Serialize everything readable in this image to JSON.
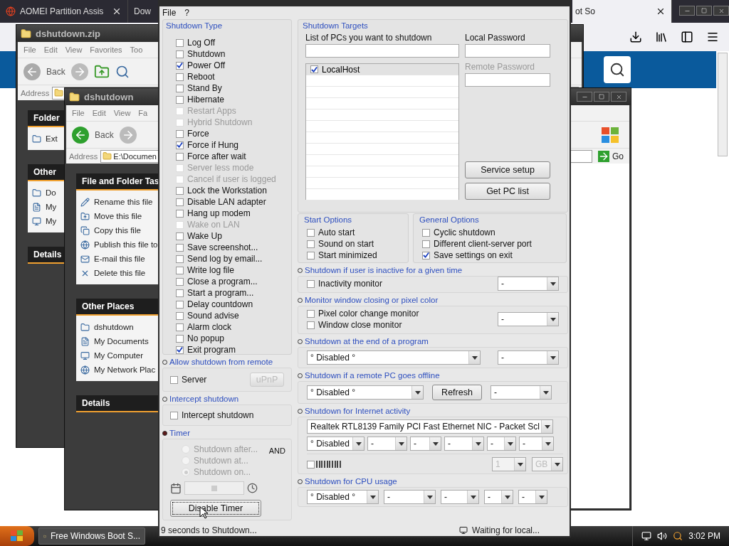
{
  "browser": {
    "tabs": [
      {
        "label": "AOMEI Partition Assis",
        "selected": false
      },
      {
        "label": "Dow",
        "selected": false
      },
      {
        "label": "ot So",
        "selected": true
      }
    ]
  },
  "explorer_back": {
    "title": "dshutdown.zip",
    "menu": [
      "File",
      "Edit",
      "View",
      "Favorites",
      "Too"
    ],
    "back": "Back",
    "address_label": "Address",
    "panels": [
      {
        "title": "Folder",
        "items": [
          "Ext"
        ]
      },
      {
        "title": "Other",
        "items": [
          "Do",
          "My",
          "My"
        ]
      },
      {
        "title": "Details"
      }
    ]
  },
  "explorer_front": {
    "title": "dshutdown",
    "menu": [
      "File",
      "Edit",
      "View",
      "Fa"
    ],
    "back": "Back",
    "address_label": "Address",
    "address": "E:\\Documen",
    "go": "Go",
    "panels": [
      {
        "title": "File and Folder Tas",
        "items": [
          "Rename this file",
          "Move this file",
          "Copy this file",
          "Publish this file to",
          "E-mail this file",
          "Delete this file"
        ]
      },
      {
        "title": "Other Places",
        "items": [
          "dshutdown",
          "My Documents",
          "My Computer",
          "My Network Plac"
        ]
      },
      {
        "title": "Details"
      }
    ]
  },
  "dialog": {
    "menu": [
      "File",
      "?"
    ],
    "shutdown_type": {
      "title": "Shutdown Type",
      "options": [
        {
          "label": "Log Off",
          "checked": false,
          "disabled": false
        },
        {
          "label": "Shutdown",
          "checked": false,
          "disabled": false
        },
        {
          "label": "Power Off",
          "checked": true,
          "disabled": false
        },
        {
          "label": "Reboot",
          "checked": false,
          "disabled": false
        },
        {
          "label": "Stand By",
          "checked": false,
          "disabled": false
        },
        {
          "label": "Hibernate",
          "checked": false,
          "disabled": false
        },
        {
          "label": "Restart Apps",
          "checked": false,
          "disabled": true
        },
        {
          "label": "Hybrid Shutdown",
          "checked": false,
          "disabled": true
        },
        {
          "label": "Force",
          "checked": false,
          "disabled": false
        },
        {
          "label": "Force if Hung",
          "checked": true,
          "disabled": false
        },
        {
          "label": "Force after wait",
          "checked": false,
          "disabled": false
        },
        {
          "label": "Server less mode",
          "checked": false,
          "disabled": true
        },
        {
          "label": "Cancel if user is logged",
          "checked": false,
          "disabled": true
        },
        {
          "label": "Lock the Workstation",
          "checked": false,
          "disabled": false
        },
        {
          "label": "Disable LAN adapter",
          "checked": false,
          "disabled": false
        },
        {
          "label": "Hang up modem",
          "checked": false,
          "disabled": false
        },
        {
          "label": "Wake on LAN",
          "checked": false,
          "disabled": true
        },
        {
          "label": "Wake Up",
          "checked": false,
          "disabled": false
        },
        {
          "label": "Save screenshot...",
          "checked": false,
          "disabled": false
        },
        {
          "label": "Send log by email...",
          "checked": false,
          "disabled": false
        },
        {
          "label": "Write log file",
          "checked": false,
          "disabled": false
        },
        {
          "label": "Close a program...",
          "checked": false,
          "disabled": false
        },
        {
          "label": "Start a program...",
          "checked": false,
          "disabled": false
        },
        {
          "label": "Delay countdown",
          "checked": false,
          "disabled": false
        },
        {
          "label": "Sound advise",
          "checked": false,
          "disabled": false
        },
        {
          "label": "Alarm clock",
          "checked": false,
          "disabled": false
        },
        {
          "label": "No popup",
          "checked": false,
          "disabled": false
        },
        {
          "label": "Exit program",
          "checked": true,
          "disabled": false
        }
      ]
    },
    "remote": {
      "title": "Allow shutdown from remote",
      "active": false,
      "server": {
        "label": "Server",
        "checked": false
      },
      "upnp": {
        "label": "uPnP",
        "disabled": true
      }
    },
    "intercept": {
      "title": "Intercept shutdown",
      "active": false,
      "option": {
        "label": "Intercept shutdown",
        "checked": false
      }
    },
    "timer": {
      "title": "Timer",
      "active": true,
      "and": "AND",
      "modes": [
        {
          "label": "Shutdown after...",
          "selected": false
        },
        {
          "label": "Shutdown at...",
          "selected": false
        },
        {
          "label": "Shutdown on...",
          "selected": true
        }
      ],
      "button": "Disable Timer"
    },
    "status": "9 seconds to Shutdown...",
    "status_right": "Waiting for local...",
    "targets": {
      "title": "Shutdown Targets",
      "list_label": "List of PCs you want to shutdown",
      "local_password": "Local Password",
      "remote_password": "Remote Password",
      "pcs": [
        {
          "name": "LocalHost",
          "checked": true
        }
      ],
      "buttons": [
        "Service setup",
        "Get PC list"
      ]
    },
    "start_options": {
      "title": "Start Options",
      "options": [
        {
          "label": "Auto start",
          "checked": false
        },
        {
          "label": "Sound on start",
          "checked": false
        },
        {
          "label": "Start minimized",
          "checked": false
        }
      ]
    },
    "general_options": {
      "title": "General Options",
      "options": [
        {
          "label": "Cyclic shutdown",
          "checked": false
        },
        {
          "label": "Different client-server port",
          "checked": false
        },
        {
          "label": "Save settings on exit",
          "checked": true
        }
      ]
    },
    "inactivity": {
      "title": "Shutdown if user is inactive for a given time",
      "active": false,
      "options": [
        {
          "label": "Inactivity monitor",
          "checked": false
        }
      ],
      "select": "-"
    },
    "monitor": {
      "title": "Monitor window closing or pixel color",
      "active": false,
      "options": [
        {
          "label": "Pixel color change monitor",
          "checked": false
        },
        {
          "label": "Window close monitor",
          "checked": false
        }
      ],
      "select": "-"
    },
    "program_end": {
      "title": "Shutdown at the end of a program",
      "active": false,
      "selects": [
        "° Disabled °",
        "-"
      ]
    },
    "remote_offline": {
      "title": "Shutdown if a remote PC goes offline",
      "active": false,
      "selects": [
        "° Disabled °",
        "-"
      ],
      "refresh": "Refresh"
    },
    "internet": {
      "title": "Shutdown for Internet activity",
      "active": false,
      "adapter": "Realtek RTL8139 Family PCI Fast Ethernet NIC - Packet Scl",
      "selects": [
        "° Disabled",
        "-",
        "-",
        "-",
        "-",
        "-"
      ],
      "checked": false,
      "amount": "1",
      "unit": "GB"
    },
    "cpu": {
      "title": "Shutdown for CPU usage",
      "active": false,
      "selects": [
        "° Disabled °",
        "-",
        "-",
        "-",
        "-"
      ]
    }
  },
  "taskbar": {
    "tasks": [
      {
        "label": "Free Windows Boot S...",
        "selected": false
      }
    ],
    "clock": "3:02 PM"
  }
}
